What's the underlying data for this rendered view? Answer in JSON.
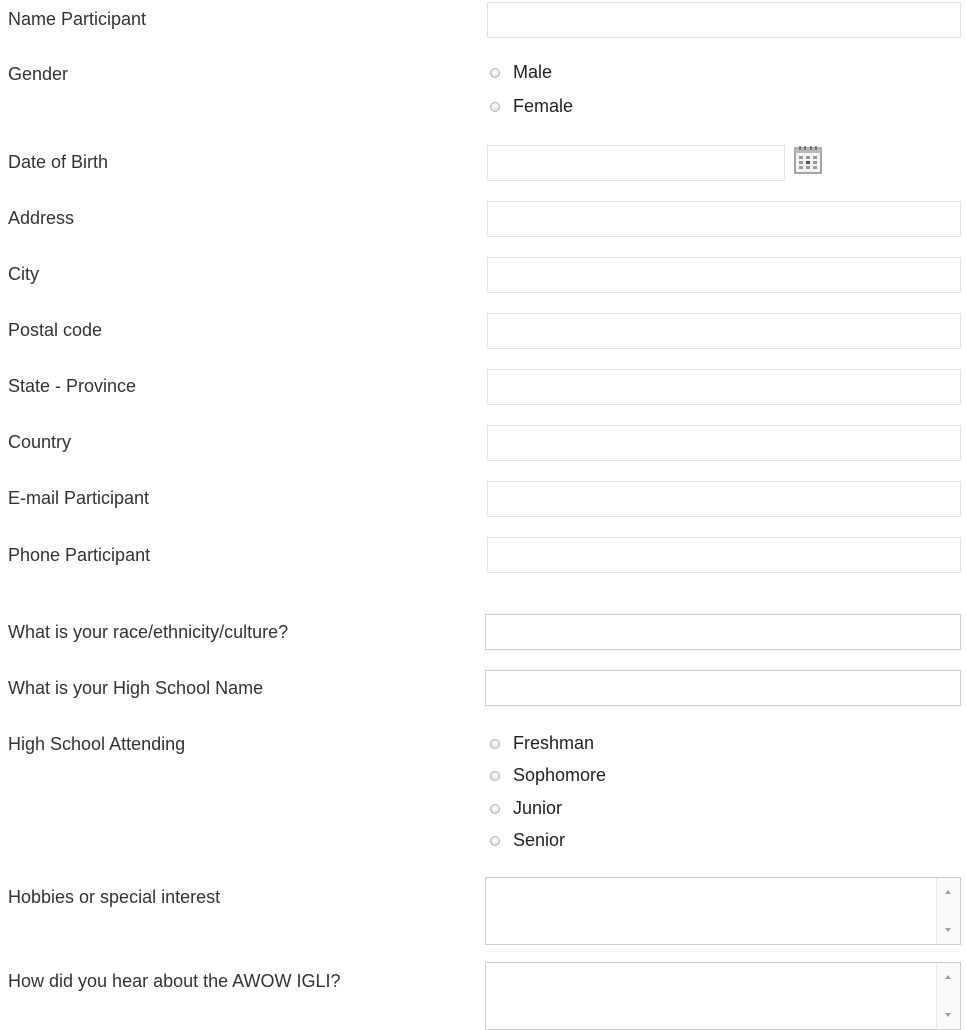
{
  "form": {
    "name_label": "Name Participant",
    "gender_label": "Gender",
    "gender_options": [
      "Male",
      "Female"
    ],
    "dob_label": "Date of Birth",
    "address_label": "Address",
    "city_label": "City",
    "postal_label": "Postal code",
    "state_label": "State - Province",
    "country_label": "Country",
    "email_label": "E-mail Participant",
    "phone_label": "Phone Participant",
    "race_label": "What is your race/ethnicity/culture?",
    "school_name_label": "What is your High School  Name",
    "attending_label": "High School Attending",
    "attending_options": [
      "Freshman",
      "Sophomore",
      "Junior",
      "Senior"
    ],
    "hobbies_label": "Hobbies or special interest",
    "hear_label": "How did you hear about the AWOW IGLI?",
    "values": {
      "name": "",
      "dob": "",
      "address": "",
      "city": "",
      "postal": "",
      "state": "",
      "country": "",
      "email": "",
      "phone": "",
      "race": "",
      "school_name": "",
      "hobbies": "",
      "hear": ""
    }
  },
  "colors": {
    "label": "#333333",
    "border": "#cccccc",
    "calendar_icon": "#8a8a8a"
  },
  "icons": {
    "date_picker": "calendar-icon"
  }
}
